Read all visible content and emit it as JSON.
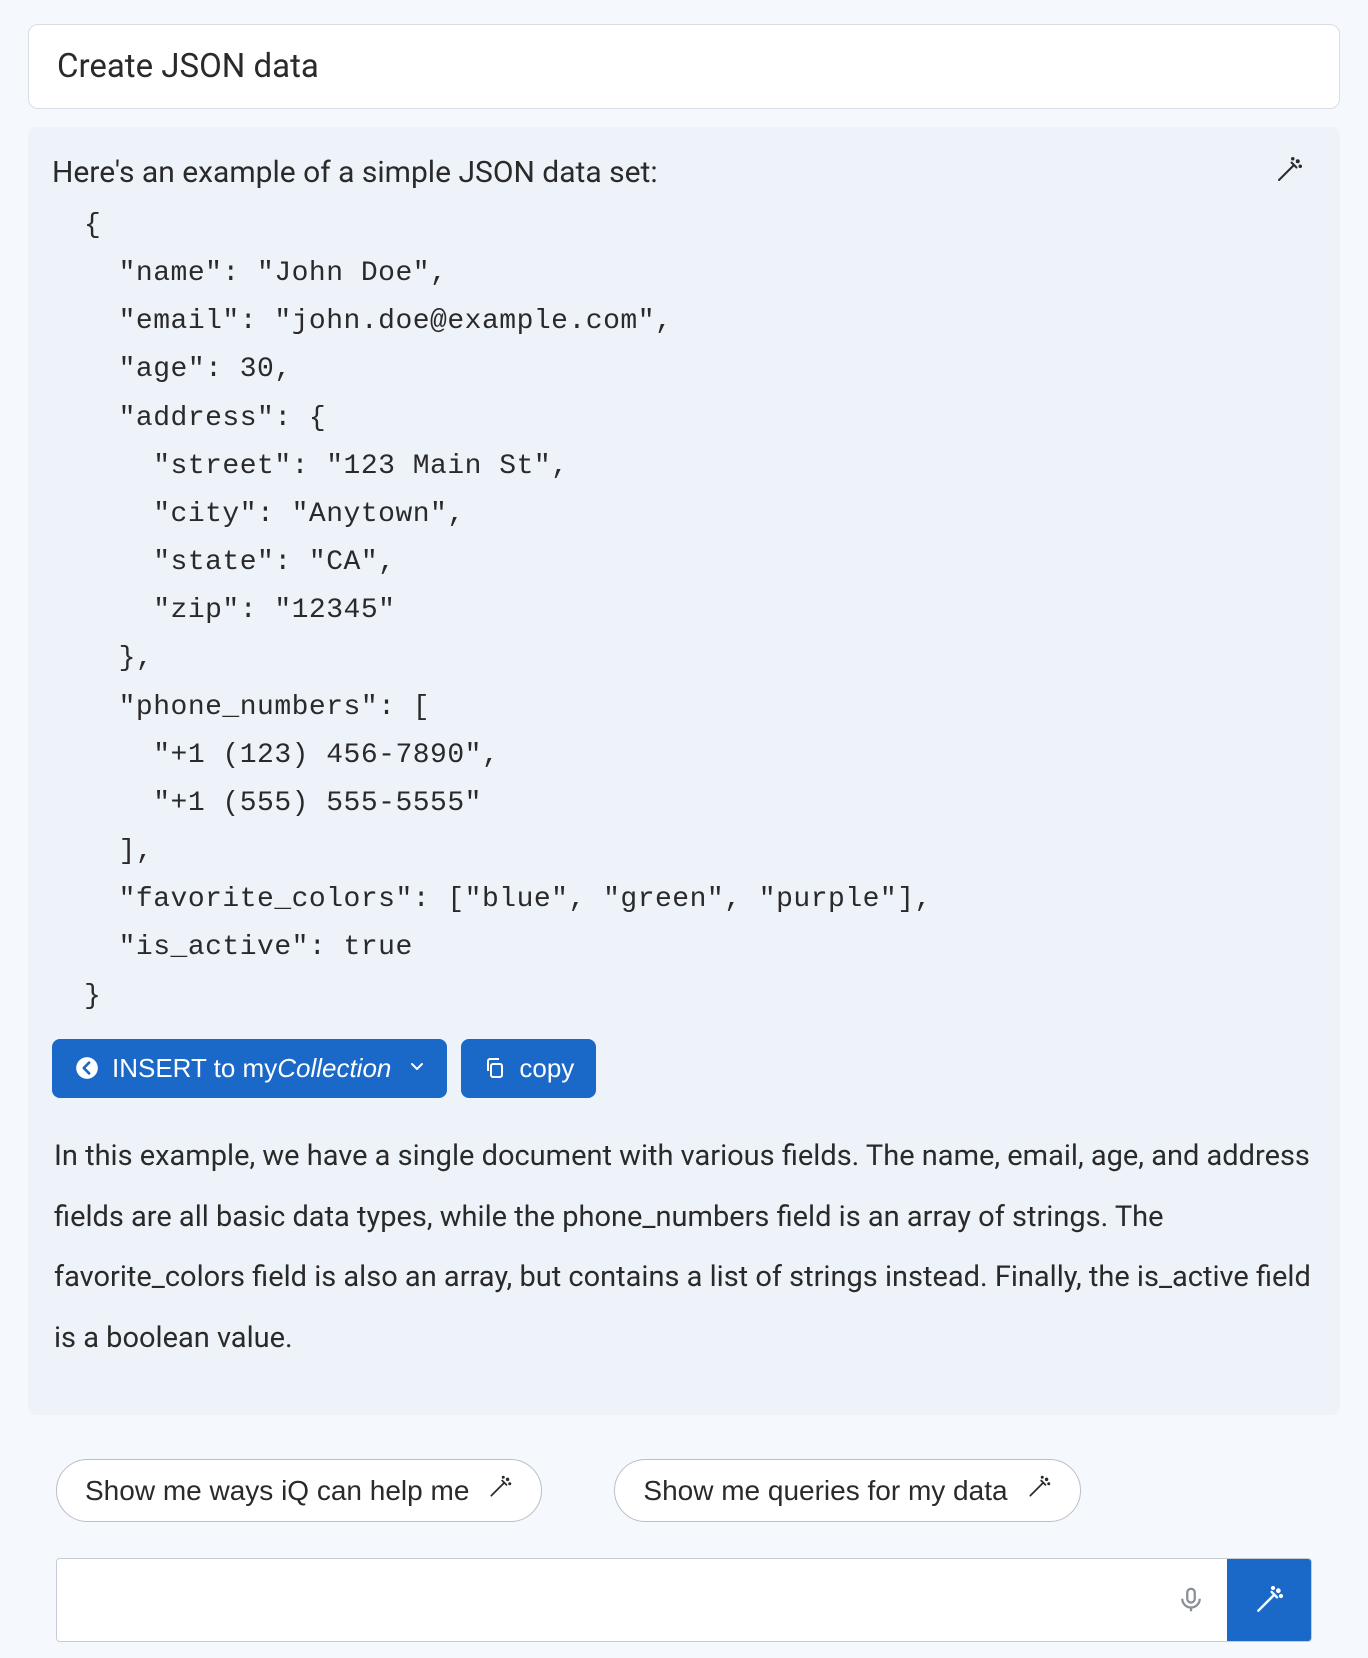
{
  "header": {
    "title": "Create JSON data"
  },
  "response": {
    "intro": "Here's an example of a simple JSON data set:",
    "code": "{\n  \"name\": \"John Doe\",\n  \"email\": \"john.doe@example.com\",\n  \"age\": 30,\n  \"address\": {\n    \"street\": \"123 Main St\",\n    \"city\": \"Anytown\",\n    \"state\": \"CA\",\n    \"zip\": \"12345\"\n  },\n  \"phone_numbers\": [\n    \"+1 (123) 456-7890\",\n    \"+1 (555) 555-5555\"\n  ],\n  \"favorite_colors\": [\"blue\", \"green\", \"purple\"],\n  \"is_active\": true\n}",
    "explanation": "In this example, we have a single document with various fields. The name, email, age, and address fields are all basic data types, while the phone_numbers field is an array of strings. The favorite_colors field is also an array, but contains a list of strings instead. Finally, the is_active field is a boolean value."
  },
  "actions": {
    "insert_prefix": "INSERT to my",
    "insert_collection": "Collection",
    "copy_label": "copy"
  },
  "suggestions": {
    "s1": "Show me ways iQ can help me",
    "s2": "Show me queries for my data"
  },
  "input": {
    "value": "",
    "placeholder": ""
  },
  "icons": {
    "wand": "magic-wand-icon",
    "arrow_left": "arrow-left-circle-icon",
    "chevron_down": "chevron-down-icon",
    "copy": "copy-icon",
    "mic": "microphone-icon"
  },
  "colors": {
    "accent": "#1a68c7",
    "panel_bg": "#eef3f9",
    "card_bg": "#ffffff",
    "text": "#2a2a2a"
  }
}
